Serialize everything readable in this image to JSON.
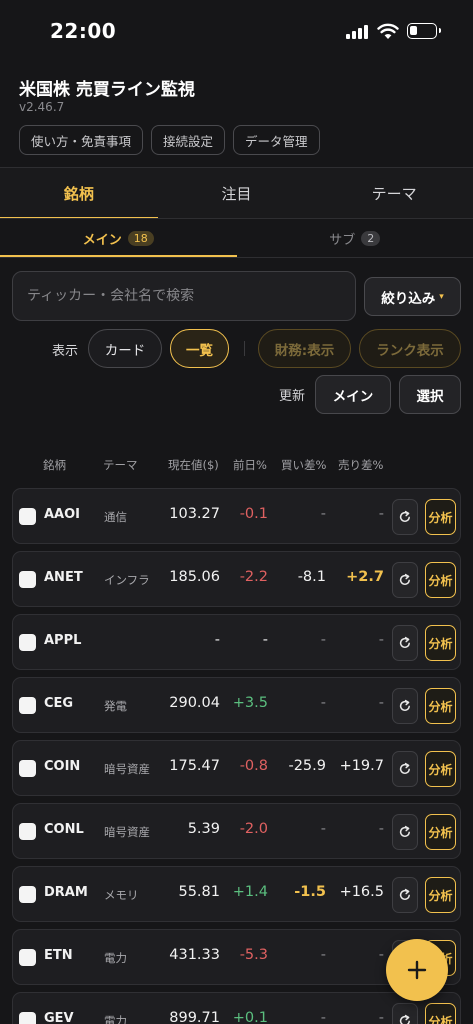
{
  "status": {
    "time": "22:00"
  },
  "header": {
    "title": "米国株 売買ライン監視",
    "version": "v2.46.7",
    "buttons": [
      "使い方・免責事項",
      "接続設定",
      "データ管理"
    ]
  },
  "main_tabs": [
    {
      "label": "銘柄",
      "active": true
    },
    {
      "label": "注目",
      "active": false
    },
    {
      "label": "テーマ",
      "active": false
    }
  ],
  "sub_tabs": [
    {
      "label": "メイン",
      "count": "18",
      "active": true
    },
    {
      "label": "サブ",
      "count": "2",
      "active": false
    }
  ],
  "search": {
    "placeholder": "ティッカー・会社名で検索",
    "filter_label": "絞り込み",
    "filter_caret": "▾"
  },
  "view": {
    "label": "表示",
    "card": "カード",
    "list": "一覧",
    "finance": "財務:表示",
    "rank": "ランク表示"
  },
  "update": {
    "label": "更新",
    "main": "メイン",
    "select": "選択"
  },
  "table": {
    "headers": [
      "銘柄",
      "テーマ",
      "現在値($)",
      "前日%",
      "買い差%",
      "売り差%"
    ],
    "analyze_label": "分析",
    "rows": [
      {
        "ticker": "AAOI",
        "theme": "通信",
        "price": "103.27",
        "chg": "-0.1",
        "buy": "-",
        "sell": "-"
      },
      {
        "ticker": "ANET",
        "theme": "インフラ",
        "price": "185.06",
        "chg": "-2.2",
        "buy": "-8.1",
        "sell": "+2.7"
      },
      {
        "ticker": "APPL",
        "theme": "",
        "price": "-",
        "chg": "-",
        "buy": "-",
        "sell": "-"
      },
      {
        "ticker": "CEG",
        "theme": "発電",
        "price": "290.04",
        "chg": "+3.5",
        "buy": "-",
        "sell": "-"
      },
      {
        "ticker": "COIN",
        "theme": "暗号資産",
        "price": "175.47",
        "chg": "-0.8",
        "buy": "-25.9",
        "sell": "+19.7"
      },
      {
        "ticker": "CONL",
        "theme": "暗号資産",
        "price": "5.39",
        "chg": "-2.0",
        "buy": "-",
        "sell": "-"
      },
      {
        "ticker": "DRAM",
        "theme": "メモリ",
        "price": "55.81",
        "chg": "+1.4",
        "buy": "-1.5",
        "sell": "+16.5"
      },
      {
        "ticker": "ETN",
        "theme": "電力",
        "price": "431.33",
        "chg": "-5.3",
        "buy": "-",
        "sell": "-"
      },
      {
        "ticker": "GEV",
        "theme": "電力",
        "price": "899.71",
        "chg": "+0.1",
        "buy": "-",
        "sell": "-"
      }
    ]
  },
  "fab": {
    "label": "+"
  },
  "colors": {
    "accent": "#f2c14e",
    "negative": "#e06161",
    "positive": "#5bbf7f",
    "background": "#161618"
  }
}
